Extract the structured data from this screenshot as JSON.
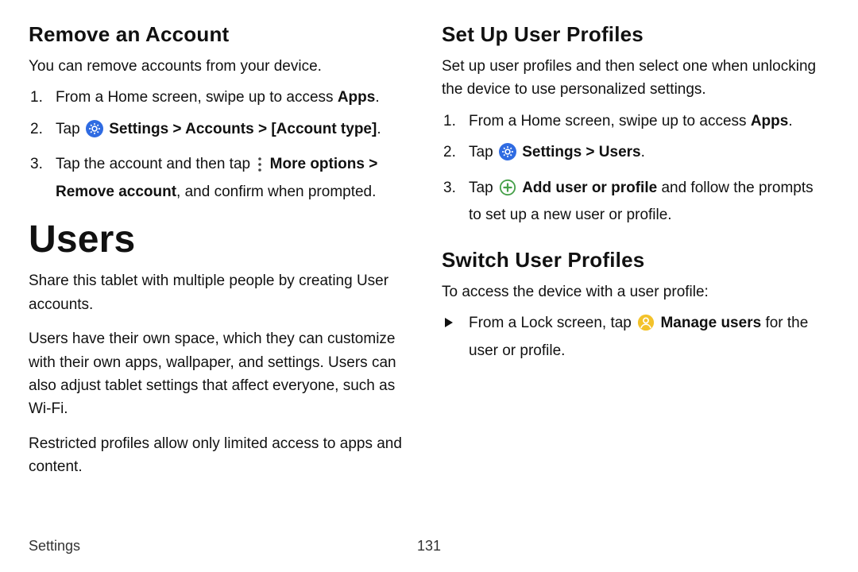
{
  "left": {
    "remove_heading": "Remove an Account",
    "remove_intro": "You can remove accounts from your device.",
    "remove_step1_pre": "From a Home screen, swipe up to access ",
    "remove_step1_bold": "Apps",
    "remove_step1_post": ".",
    "remove_step2_pre": "Tap ",
    "remove_step2_bold": "Settings > Accounts > [Account type]",
    "remove_step2_post": ".",
    "remove_step3_pre": "Tap the account and then tap ",
    "remove_step3_bold1": "More options > Remove account",
    "remove_step3_post": ", and confirm when prompted.",
    "users_heading": "Users",
    "users_p1": "Share this tablet with multiple people by creating User accounts.",
    "users_p2": "Users have their own space, which they can customize with their own apps, wallpaper, and settings. Users can also adjust tablet settings that affect everyone, such as Wi‑Fi.",
    "users_p3": "Restricted profiles allow only limited access to apps and content."
  },
  "right": {
    "setup_heading": "Set Up User Profiles",
    "setup_intro": "Set up user profiles and then select one when unlocking the device to use personalized settings.",
    "setup_step1_pre": "From a Home screen, swipe up to access ",
    "setup_step1_bold": "Apps",
    "setup_step1_post": ".",
    "setup_step2_pre": "Tap ",
    "setup_step2_bold": "Settings > Users",
    "setup_step2_post": ".",
    "setup_step3_pre": "Tap ",
    "setup_step3_bold": "Add user or profile",
    "setup_step3_post": " and follow the prompts to set up a new user or profile.",
    "switch_heading": "Switch User Profiles",
    "switch_intro": "To access the device with a user profile:",
    "switch_bullet_pre": "From a Lock screen, tap ",
    "switch_bullet_bold": "Manage users",
    "switch_bullet_post": " for the user or profile."
  },
  "footer": {
    "section": "Settings",
    "page": "131"
  },
  "icons": {
    "settings": "settings-gear-icon",
    "more": "more-vertical-icon",
    "add": "add-circle-icon",
    "user": "user-circle-icon"
  },
  "colors": {
    "settings_bg": "#2f6be2",
    "add_stroke": "#46a049",
    "user_bg": "#f3c22a"
  }
}
